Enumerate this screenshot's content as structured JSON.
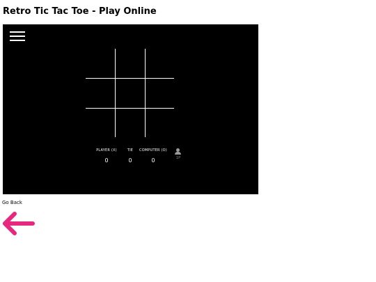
{
  "page": {
    "title": "Retro Tic Tac Toe - Play Online"
  },
  "game": {
    "menu_icon": "hamburger-menu-icon",
    "board": {
      "cells": [
        "",
        "",
        "",
        "",
        "",
        "",
        "",
        "",
        ""
      ]
    },
    "scoreboard": {
      "player_label": "PLAYER (X)",
      "player_score": "0",
      "tie_label": "TIE",
      "tie_score": "0",
      "computer_label": "COMPUTER (O)",
      "computer_score": "0"
    },
    "mode_toggle": {
      "icon": "person-icon",
      "label": "1P"
    }
  },
  "navigation": {
    "go_back_label": "Go Back",
    "back_icon": "arrow-left-icon",
    "back_color": "#e6297e"
  },
  "colors": {
    "game_background": "#000000",
    "grid_lines": "#ffffff",
    "accent_back": "#e6297e"
  }
}
